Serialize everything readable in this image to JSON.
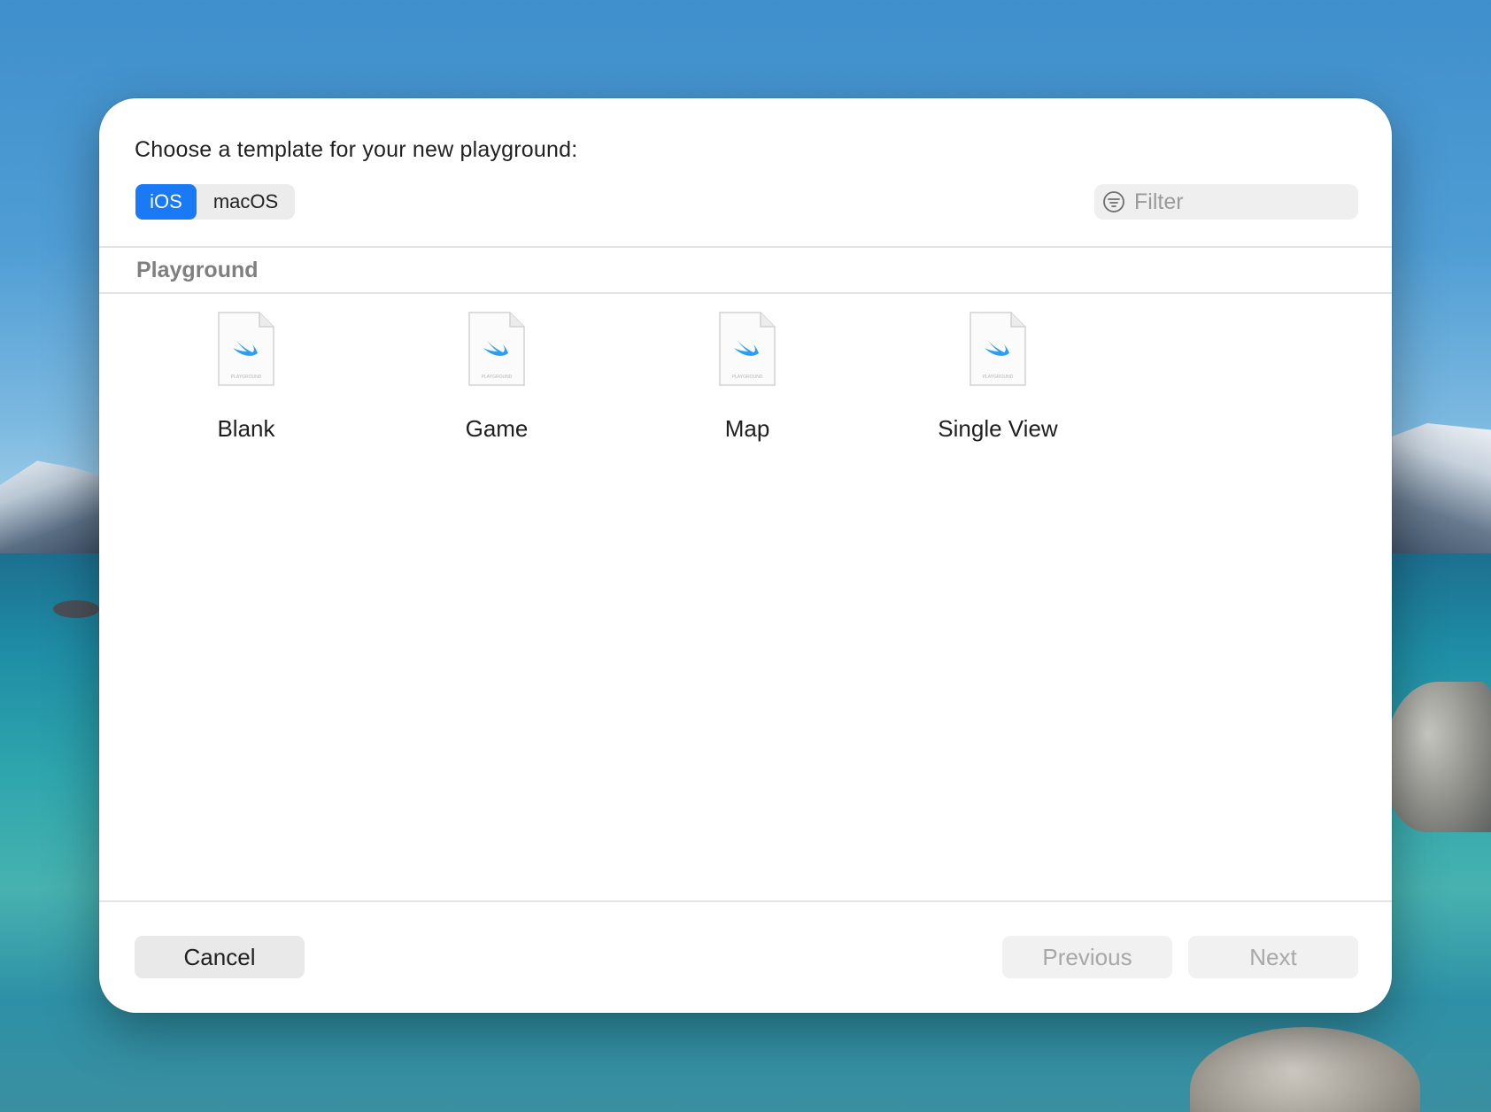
{
  "dialog": {
    "title": "Choose a template for your new playground:",
    "platform_tabs": [
      {
        "label": "iOS",
        "selected": true
      },
      {
        "label": "macOS",
        "selected": false
      }
    ],
    "filter": {
      "placeholder": "Filter",
      "value": ""
    },
    "section": "Playground",
    "templates": [
      {
        "label": "Blank",
        "icon": "swift-playground-file-icon",
        "badge": "PLAYGROUND"
      },
      {
        "label": "Game",
        "icon": "swift-playground-file-icon",
        "badge": "PLAYGROUND"
      },
      {
        "label": "Map",
        "icon": "swift-playground-file-icon",
        "badge": "PLAYGROUND"
      },
      {
        "label": "Single View",
        "icon": "swift-playground-file-icon",
        "badge": "PLAYGROUND"
      }
    ],
    "buttons": {
      "cancel": "Cancel",
      "previous": "Previous",
      "next": "Next"
    },
    "colors": {
      "accent": "#1a7af6",
      "swift_icon": "#2a9df4"
    }
  }
}
